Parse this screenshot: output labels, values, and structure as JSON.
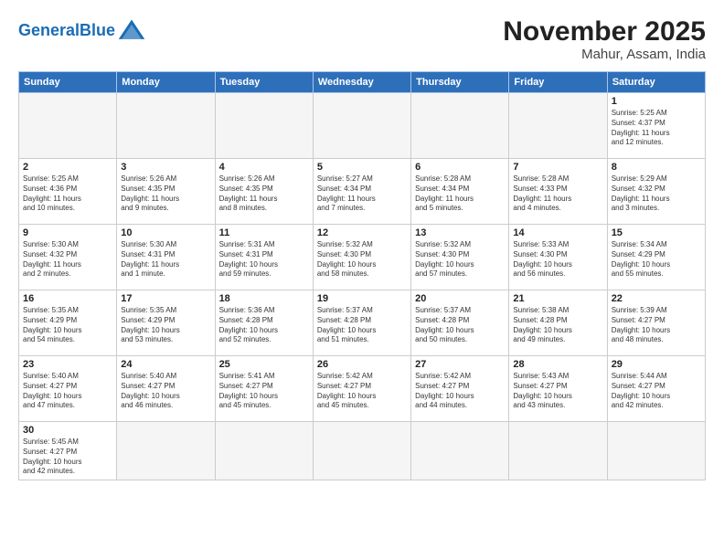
{
  "logo": {
    "text_general": "General",
    "text_blue": "Blue"
  },
  "title": "November 2025",
  "subtitle": "Mahur, Assam, India",
  "days_of_week": [
    "Sunday",
    "Monday",
    "Tuesday",
    "Wednesday",
    "Thursday",
    "Friday",
    "Saturday"
  ],
  "weeks": [
    [
      {
        "day": "",
        "info": ""
      },
      {
        "day": "",
        "info": ""
      },
      {
        "day": "",
        "info": ""
      },
      {
        "day": "",
        "info": ""
      },
      {
        "day": "",
        "info": ""
      },
      {
        "day": "",
        "info": ""
      },
      {
        "day": "1",
        "info": "Sunrise: 5:25 AM\nSunset: 4:37 PM\nDaylight: 11 hours\nand 12 minutes."
      }
    ],
    [
      {
        "day": "2",
        "info": "Sunrise: 5:25 AM\nSunset: 4:36 PM\nDaylight: 11 hours\nand 10 minutes."
      },
      {
        "day": "3",
        "info": "Sunrise: 5:26 AM\nSunset: 4:35 PM\nDaylight: 11 hours\nand 9 minutes."
      },
      {
        "day": "4",
        "info": "Sunrise: 5:26 AM\nSunset: 4:35 PM\nDaylight: 11 hours\nand 8 minutes."
      },
      {
        "day": "5",
        "info": "Sunrise: 5:27 AM\nSunset: 4:34 PM\nDaylight: 11 hours\nand 7 minutes."
      },
      {
        "day": "6",
        "info": "Sunrise: 5:28 AM\nSunset: 4:34 PM\nDaylight: 11 hours\nand 5 minutes."
      },
      {
        "day": "7",
        "info": "Sunrise: 5:28 AM\nSunset: 4:33 PM\nDaylight: 11 hours\nand 4 minutes."
      },
      {
        "day": "8",
        "info": "Sunrise: 5:29 AM\nSunset: 4:32 PM\nDaylight: 11 hours\nand 3 minutes."
      }
    ],
    [
      {
        "day": "9",
        "info": "Sunrise: 5:30 AM\nSunset: 4:32 PM\nDaylight: 11 hours\nand 2 minutes."
      },
      {
        "day": "10",
        "info": "Sunrise: 5:30 AM\nSunset: 4:31 PM\nDaylight: 11 hours\nand 1 minute."
      },
      {
        "day": "11",
        "info": "Sunrise: 5:31 AM\nSunset: 4:31 PM\nDaylight: 10 hours\nand 59 minutes."
      },
      {
        "day": "12",
        "info": "Sunrise: 5:32 AM\nSunset: 4:30 PM\nDaylight: 10 hours\nand 58 minutes."
      },
      {
        "day": "13",
        "info": "Sunrise: 5:32 AM\nSunset: 4:30 PM\nDaylight: 10 hours\nand 57 minutes."
      },
      {
        "day": "14",
        "info": "Sunrise: 5:33 AM\nSunset: 4:30 PM\nDaylight: 10 hours\nand 56 minutes."
      },
      {
        "day": "15",
        "info": "Sunrise: 5:34 AM\nSunset: 4:29 PM\nDaylight: 10 hours\nand 55 minutes."
      }
    ],
    [
      {
        "day": "16",
        "info": "Sunrise: 5:35 AM\nSunset: 4:29 PM\nDaylight: 10 hours\nand 54 minutes."
      },
      {
        "day": "17",
        "info": "Sunrise: 5:35 AM\nSunset: 4:29 PM\nDaylight: 10 hours\nand 53 minutes."
      },
      {
        "day": "18",
        "info": "Sunrise: 5:36 AM\nSunset: 4:28 PM\nDaylight: 10 hours\nand 52 minutes."
      },
      {
        "day": "19",
        "info": "Sunrise: 5:37 AM\nSunset: 4:28 PM\nDaylight: 10 hours\nand 51 minutes."
      },
      {
        "day": "20",
        "info": "Sunrise: 5:37 AM\nSunset: 4:28 PM\nDaylight: 10 hours\nand 50 minutes."
      },
      {
        "day": "21",
        "info": "Sunrise: 5:38 AM\nSunset: 4:28 PM\nDaylight: 10 hours\nand 49 minutes."
      },
      {
        "day": "22",
        "info": "Sunrise: 5:39 AM\nSunset: 4:27 PM\nDaylight: 10 hours\nand 48 minutes."
      }
    ],
    [
      {
        "day": "23",
        "info": "Sunrise: 5:40 AM\nSunset: 4:27 PM\nDaylight: 10 hours\nand 47 minutes."
      },
      {
        "day": "24",
        "info": "Sunrise: 5:40 AM\nSunset: 4:27 PM\nDaylight: 10 hours\nand 46 minutes."
      },
      {
        "day": "25",
        "info": "Sunrise: 5:41 AM\nSunset: 4:27 PM\nDaylight: 10 hours\nand 45 minutes."
      },
      {
        "day": "26",
        "info": "Sunrise: 5:42 AM\nSunset: 4:27 PM\nDaylight: 10 hours\nand 45 minutes."
      },
      {
        "day": "27",
        "info": "Sunrise: 5:42 AM\nSunset: 4:27 PM\nDaylight: 10 hours\nand 44 minutes."
      },
      {
        "day": "28",
        "info": "Sunrise: 5:43 AM\nSunset: 4:27 PM\nDaylight: 10 hours\nand 43 minutes."
      },
      {
        "day": "29",
        "info": "Sunrise: 5:44 AM\nSunset: 4:27 PM\nDaylight: 10 hours\nand 42 minutes."
      }
    ],
    [
      {
        "day": "30",
        "info": "Sunrise: 5:45 AM\nSunset: 4:27 PM\nDaylight: 10 hours\nand 42 minutes."
      },
      {
        "day": "",
        "info": ""
      },
      {
        "day": "",
        "info": ""
      },
      {
        "day": "",
        "info": ""
      },
      {
        "day": "",
        "info": ""
      },
      {
        "day": "",
        "info": ""
      },
      {
        "day": "",
        "info": ""
      }
    ]
  ]
}
